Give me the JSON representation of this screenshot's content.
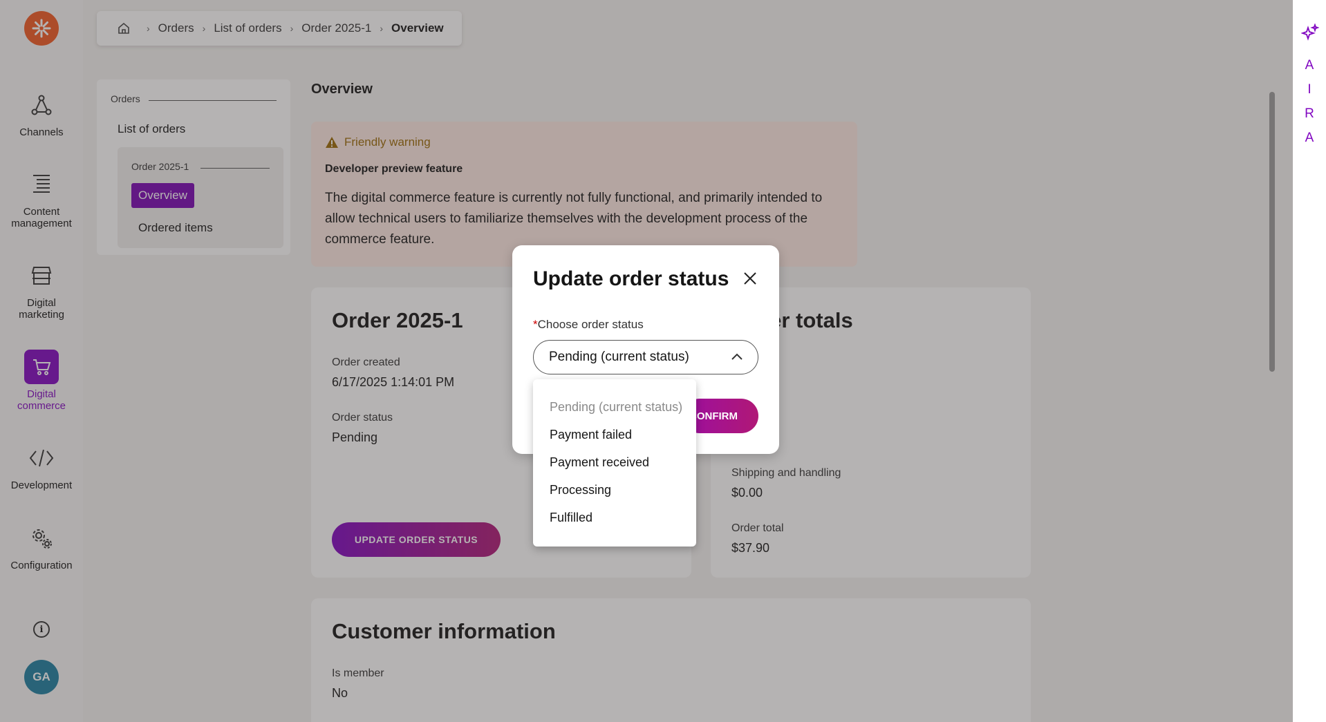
{
  "breadcrumb": {
    "items": [
      "Orders",
      "List of orders",
      "Order 2025-1",
      "Overview"
    ]
  },
  "leftnav": {
    "items": [
      {
        "label_lines": [
          "Channels"
        ]
      },
      {
        "label_lines": [
          "Content",
          "management"
        ]
      },
      {
        "label_lines": [
          "Digital",
          "marketing"
        ]
      },
      {
        "label_lines": [
          "Digital",
          "commerce"
        ]
      },
      {
        "label_lines": [
          "Development"
        ]
      },
      {
        "label_lines": [
          "Configuration"
        ]
      }
    ],
    "avatar_initials": "GA",
    "active_color": "#8107c1"
  },
  "tree": {
    "section": "Orders",
    "list_of_orders": "List of orders",
    "order_group": "Order 2025-1",
    "overview": "Overview",
    "ordered_items": "Ordered items"
  },
  "main": {
    "title": "Overview",
    "warning": {
      "title": "Friendly warning",
      "subtitle": "Developer preview feature",
      "text": "The digital commerce feature is currently not fully functional, and primarily intended to allow technical users to familiarize themselves with the development process of the commerce feature."
    },
    "order_card": {
      "title": "Order 2025-1",
      "created_label": "Order created",
      "created_value": "6/17/2025 1:14:01 PM",
      "status_label": "Order status",
      "status_value": "Pending",
      "update_button": "UPDATE ORDER STATUS"
    },
    "totals_card": {
      "title": "Order totals",
      "shipping_label": "Shipping and handling",
      "shipping_value": "$0.00",
      "total_label": "Order total",
      "total_value": "$37.90"
    },
    "customer_card": {
      "title": "Customer information",
      "member_label": "Is member",
      "member_value": "No"
    }
  },
  "rail": {
    "letters": [
      "A",
      "I",
      "R",
      "A"
    ]
  },
  "modal": {
    "title": "Update order status",
    "required_mark": "*",
    "field_label": "Choose order status",
    "selected": "Pending (current status)",
    "confirm": "CONFIRM",
    "options": [
      {
        "label": "Pending (current status)",
        "disabled": true
      },
      {
        "label": "Payment failed",
        "disabled": false
      },
      {
        "label": "Payment received",
        "disabled": false
      },
      {
        "label": "Processing",
        "disabled": false
      },
      {
        "label": "Fulfilled",
        "disabled": false
      }
    ]
  }
}
